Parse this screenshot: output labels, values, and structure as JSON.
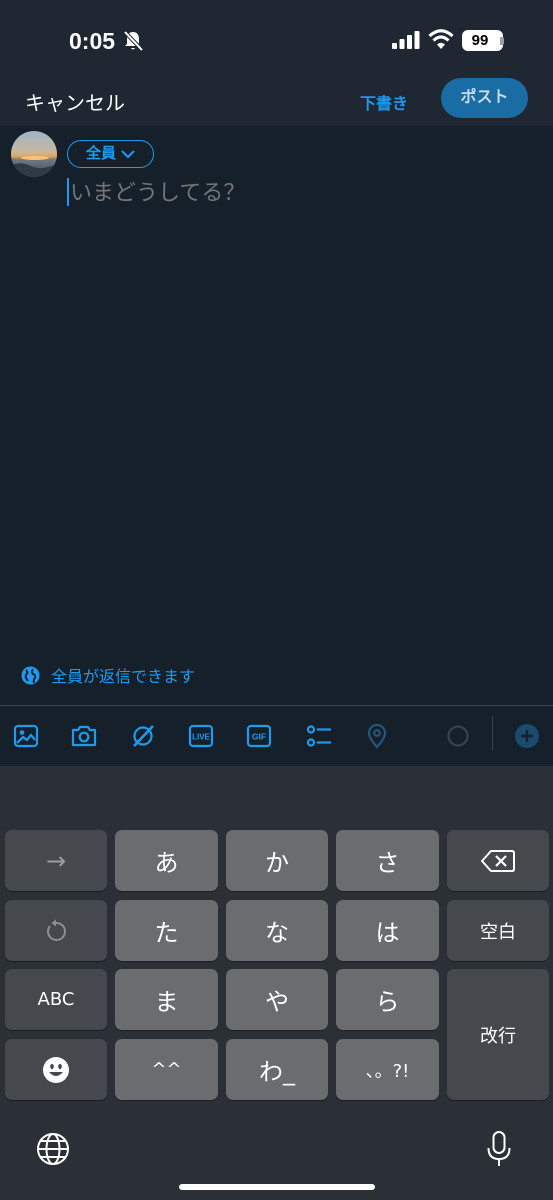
{
  "status_bar": {
    "time": "0:05",
    "battery": "99"
  },
  "header": {
    "cancel_label": "キャンセル",
    "drafts_label": "下書き",
    "post_label": "ポスト"
  },
  "compose": {
    "audience_label": "全員",
    "placeholder": "いまどうしてる？"
  },
  "reply_setting": {
    "label": "全員が返信できます"
  },
  "toolbar": {
    "icons": [
      "image-icon",
      "camera-icon",
      "grok-icon",
      "live-icon",
      "gif-icon",
      "poll-icon",
      "location-icon",
      "progress-circle-icon",
      "add-icon"
    ],
    "live_text": "LIVE",
    "gif_text": "GIF"
  },
  "keyboard": {
    "row1": [
      "→",
      "あ",
      "か",
      "さ"
    ],
    "row2": [
      "た",
      "な",
      "は",
      "空白"
    ],
    "row3": [
      "ABC",
      "ま",
      "や",
      "ら"
    ],
    "row4": [
      "^^",
      "わ_",
      "、。?!"
    ],
    "enter": "改行"
  },
  "colors": {
    "accent": "#1d9bf0",
    "background": "#15202b",
    "header_bg": "#1e2732",
    "keyboard_bg": "#2b3036"
  }
}
